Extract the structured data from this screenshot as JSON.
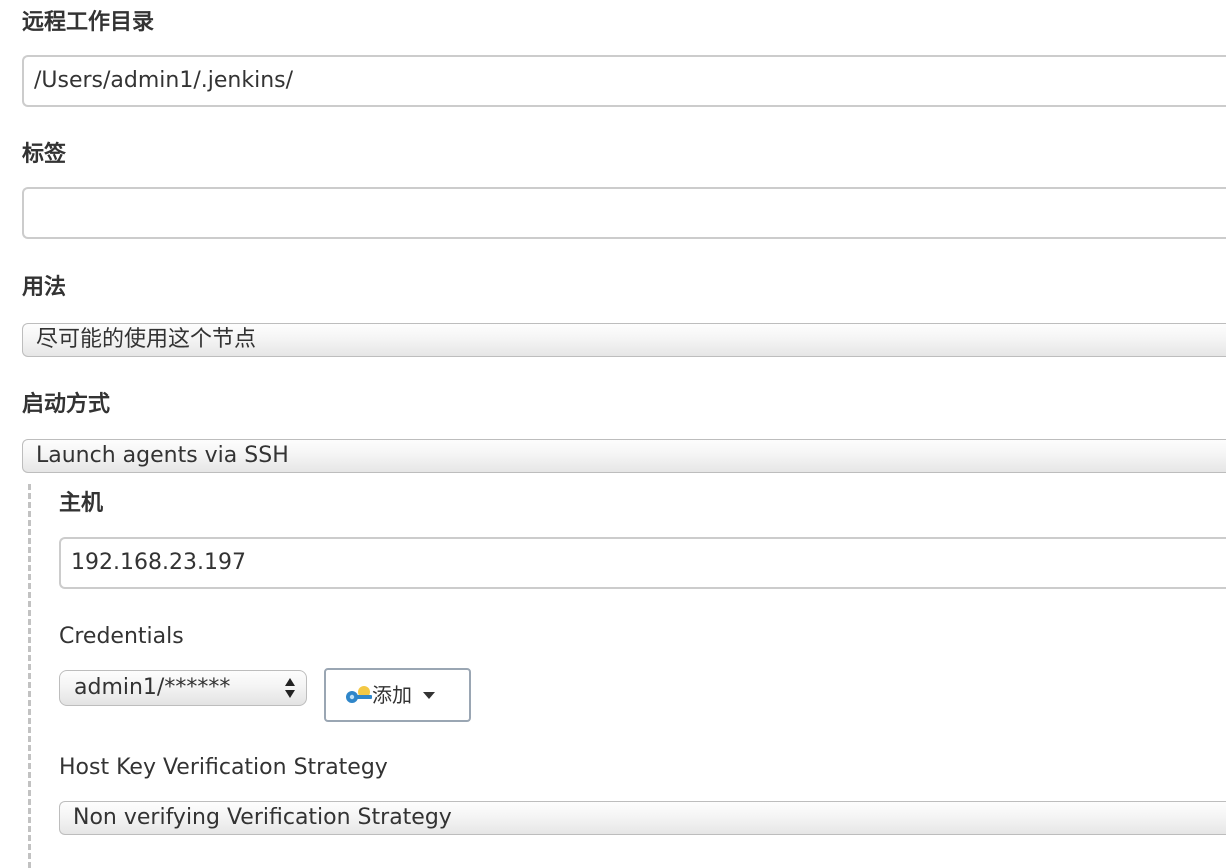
{
  "fields": {
    "remote_dir": {
      "label": "远程工作目录",
      "value": "/Users/admin1/.jenkins/"
    },
    "labels": {
      "label": "标签",
      "value": ""
    },
    "usage": {
      "label": "用法",
      "value": "尽可能的使用这个节点"
    },
    "launch": {
      "label": "启动方式",
      "value": "Launch agents via SSH"
    }
  },
  "ssh": {
    "host": {
      "label": "主机",
      "value": "192.168.23.197"
    },
    "credentials": {
      "label": "Credentials",
      "selected": "admin1/******",
      "add_button_label": "添加"
    },
    "host_key": {
      "label": "Host Key Verification Strategy",
      "value": "Non verifying Verification Strategy"
    }
  },
  "icons": {
    "key": "key-icon",
    "caret": "caret-down-icon",
    "select_arrows": "up-down-arrows-icon"
  },
  "colors": {
    "text": "#333333",
    "border": "#cccccc",
    "key_blue": "#2f86c9",
    "key_yellow": "#f2c230"
  }
}
